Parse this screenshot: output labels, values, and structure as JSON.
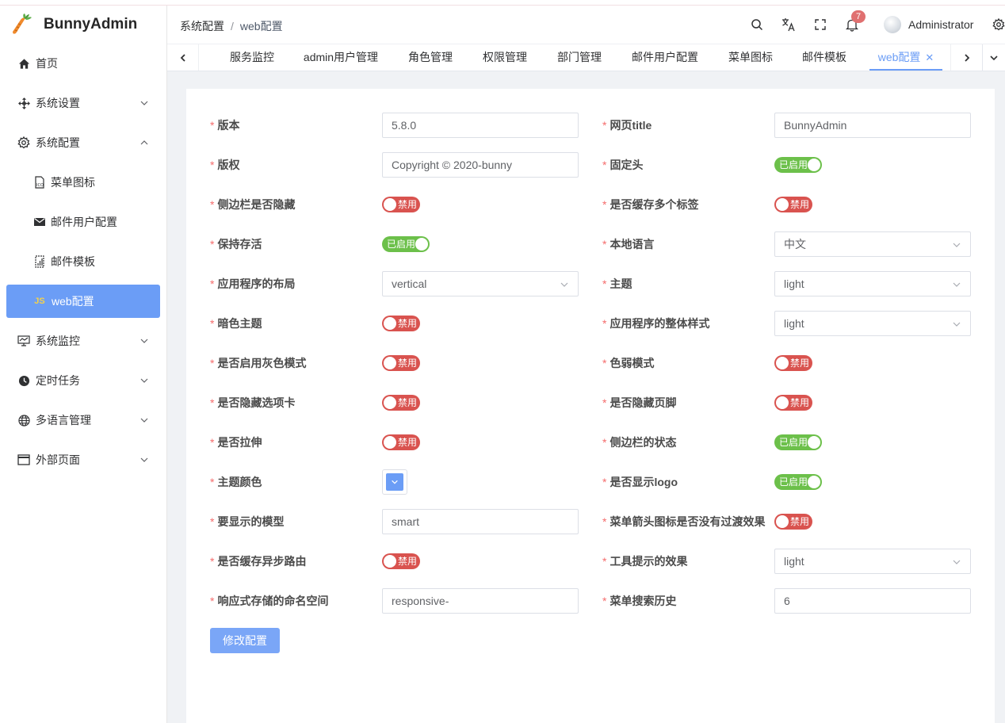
{
  "app": {
    "name": "BunnyAdmin"
  },
  "sidebar": {
    "items": [
      {
        "label": "首页",
        "icon": "home-icon"
      },
      {
        "label": "系统设置",
        "icon": "settings-move-icon"
      },
      {
        "label": "系统配置",
        "icon": "gear-icon"
      },
      {
        "label": "菜单图标",
        "icon": "icon-file-icon"
      },
      {
        "label": "邮件用户配置",
        "icon": "mail-icon"
      },
      {
        "label": "邮件模板",
        "icon": "template-icon"
      },
      {
        "label": "web配置",
        "icon": "js-icon"
      },
      {
        "label": "系统监控",
        "icon": "monitor-icon"
      },
      {
        "label": "定时任务",
        "icon": "clock-icon"
      },
      {
        "label": "多语言管理",
        "icon": "globe-icon"
      },
      {
        "label": "外部页面",
        "icon": "window-icon"
      }
    ]
  },
  "header": {
    "breadcrumb": [
      "系统配置",
      "web配置"
    ],
    "separator": "/",
    "notification_count": "7",
    "username": "Administrator"
  },
  "tabs": {
    "items": [
      "服务监控",
      "admin用户管理",
      "角色管理",
      "权限管理",
      "部门管理",
      "邮件用户配置",
      "菜单图标",
      "邮件模板",
      "web配置"
    ],
    "close": "✕"
  },
  "form": {
    "required_mark": "*",
    "fields": {
      "version": {
        "label": "版本",
        "value": "5.8.0"
      },
      "title": {
        "label": "网页title",
        "value": "BunnyAdmin"
      },
      "copyright": {
        "label": "版权",
        "value": "Copyright © 2020-bunny"
      },
      "fixed_header": {
        "label": "固定头",
        "state": "已启用"
      },
      "hide_sidebar": {
        "label": "侧边栏是否隐藏",
        "state": "禁用"
      },
      "cache_tags": {
        "label": "是否缓存多个标签",
        "state": "禁用"
      },
      "keep_alive": {
        "label": "保持存活",
        "state": "已启用"
      },
      "locale": {
        "label": "本地语言",
        "value": "中文"
      },
      "layout": {
        "label": "应用程序的布局",
        "value": "vertical"
      },
      "theme": {
        "label": "主题",
        "value": "light"
      },
      "dark_theme": {
        "label": "暗色主题",
        "state": "禁用"
      },
      "overall_style": {
        "label": "应用程序的整体样式",
        "value": "light"
      },
      "grey_mode": {
        "label": "是否启用灰色模式",
        "state": "禁用"
      },
      "weak_mode": {
        "label": "色弱模式",
        "state": "禁用"
      },
      "hide_tabs": {
        "label": "是否隐藏选项卡",
        "state": "禁用"
      },
      "hide_footer": {
        "label": "是否隐藏页脚",
        "state": "禁用"
      },
      "stretch": {
        "label": "是否拉伸",
        "state": "禁用"
      },
      "sidebar_status": {
        "label": "侧边栏的状态",
        "state": "已启用"
      },
      "theme_color": {
        "label": "主题颜色",
        "color": "#6b9df6"
      },
      "show_logo": {
        "label": "是否显示logo",
        "state": "已启用"
      },
      "show_model": {
        "label": "要显示的模型",
        "value": "smart"
      },
      "menu_arrow": {
        "label": "菜单箭头图标是否没有过渡效果",
        "state": "禁用"
      },
      "cache_async_route": {
        "label": "是否缓存异步路由",
        "state": "禁用"
      },
      "tooltip_effect": {
        "label": "工具提示的效果",
        "value": "light"
      },
      "storage_namespace": {
        "label": "响应式存储的命名空间",
        "value": "responsive-"
      },
      "menu_search_history": {
        "label": "菜单搜索历史",
        "value": "6"
      }
    },
    "submit_label": "修改配置"
  },
  "colors": {
    "accent": "#6b9df6",
    "switch_on": "#6cc04a",
    "switch_off": "#d9534f",
    "required": "#f56c6c"
  }
}
